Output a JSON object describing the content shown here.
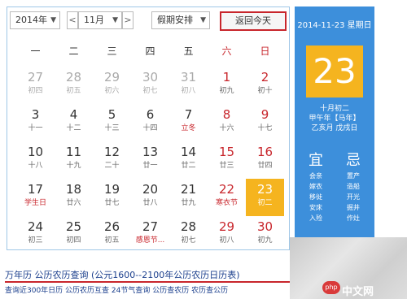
{
  "toolbar": {
    "year": "2014年",
    "prev": "<",
    "month": "11月",
    "next": ">",
    "holiday": "假期安排",
    "today": "返回今天"
  },
  "weekdays": [
    "一",
    "二",
    "三",
    "四",
    "五",
    "六",
    "日"
  ],
  "weeks": [
    [
      {
        "d": "27",
        "l": "初四",
        "o": true
      },
      {
        "d": "28",
        "l": "初五",
        "o": true
      },
      {
        "d": "29",
        "l": "初六",
        "o": true
      },
      {
        "d": "30",
        "l": "初七",
        "o": true
      },
      {
        "d": "31",
        "l": "初八",
        "o": true
      },
      {
        "d": "1",
        "l": "初九",
        "we": true
      },
      {
        "d": "2",
        "l": "初十",
        "we": true
      }
    ],
    [
      {
        "d": "3",
        "l": "十一"
      },
      {
        "d": "4",
        "l": "十二"
      },
      {
        "d": "5",
        "l": "十三"
      },
      {
        "d": "6",
        "l": "十四"
      },
      {
        "d": "7",
        "l": "立冬",
        "red": true
      },
      {
        "d": "8",
        "l": "十六",
        "we": true
      },
      {
        "d": "9",
        "l": "十七",
        "we": true
      }
    ],
    [
      {
        "d": "10",
        "l": "十八"
      },
      {
        "d": "11",
        "l": "十九"
      },
      {
        "d": "12",
        "l": "二十"
      },
      {
        "d": "13",
        "l": "廿一"
      },
      {
        "d": "14",
        "l": "廿二"
      },
      {
        "d": "15",
        "l": "廿三",
        "we": true
      },
      {
        "d": "16",
        "l": "廿四",
        "we": true
      }
    ],
    [
      {
        "d": "17",
        "l": "学生日",
        "red": true
      },
      {
        "d": "18",
        "l": "廿六"
      },
      {
        "d": "19",
        "l": "廿七"
      },
      {
        "d": "20",
        "l": "廿八"
      },
      {
        "d": "21",
        "l": "廿九"
      },
      {
        "d": "22",
        "l": "寒衣节",
        "we": true,
        "red": true
      },
      {
        "d": "23",
        "l": "初二",
        "sel": true
      }
    ],
    [
      {
        "d": "24",
        "l": "初三"
      },
      {
        "d": "25",
        "l": "初四"
      },
      {
        "d": "26",
        "l": "初五"
      },
      {
        "d": "27",
        "l": "感恩节...",
        "red": true
      },
      {
        "d": "28",
        "l": "初七"
      },
      {
        "d": "29",
        "l": "初八",
        "we": true
      },
      {
        "d": "30",
        "l": "初九",
        "we": true
      }
    ]
  ],
  "side": {
    "date_line": "2014-11-23 星期日",
    "big_day": "23",
    "lunar_1": "十月初二",
    "lunar_2": "甲午年【马年】",
    "lunar_3": "乙亥月 戊戌日",
    "yi": "宜",
    "ji": "忌",
    "yi_items": [
      "会亲",
      "嫁衣",
      "移徙",
      "安床",
      "入殓"
    ],
    "ji_items": [
      "置产",
      "造船",
      "开光",
      "掘井",
      "作灶"
    ]
  },
  "links": {
    "top": "万年历 公历农历查询 (公元1600--2100年公历农历日历表)",
    "bottom": "查询近300年日历 公历农历互查 24节气查询   公历查农历 农历查公历"
  },
  "watermark": "中文网",
  "watermark_logo": "php"
}
